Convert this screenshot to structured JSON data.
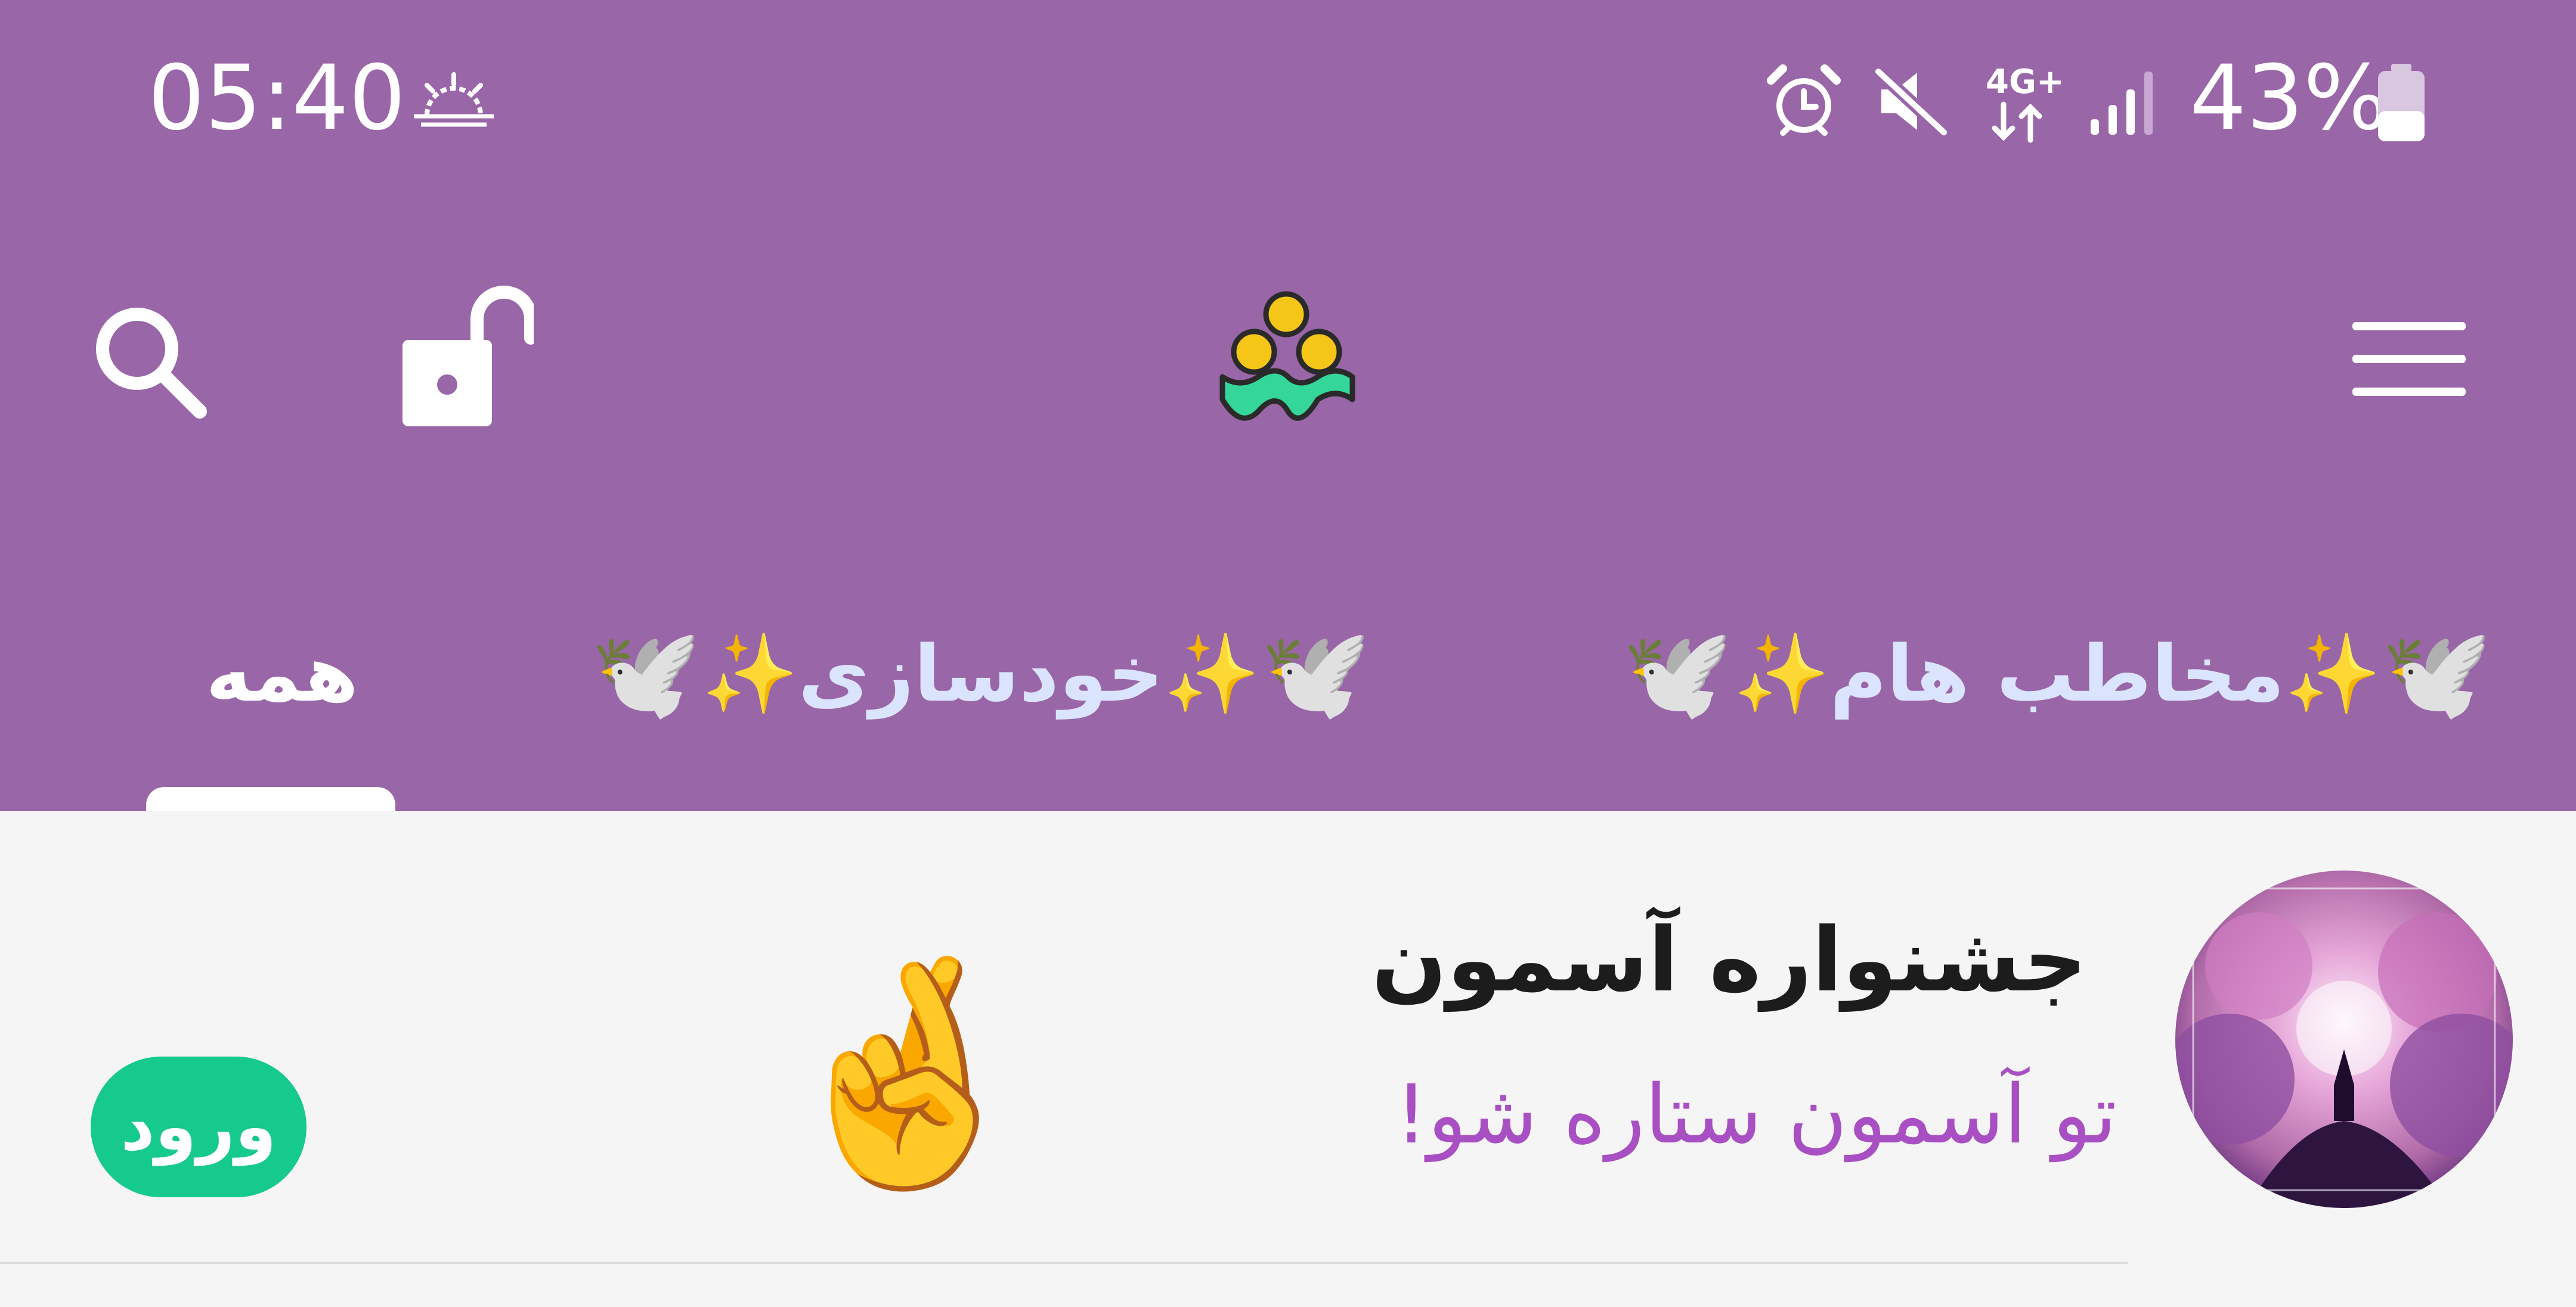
{
  "colors": {
    "header_bg": "#9966a8",
    "tab_text_active": "#ffffff",
    "tab_text_inactive": "#dbe4ff",
    "accent_green": "#16c98c",
    "subtitle_purple": "#a84fc3",
    "list_bg": "#f5f5f5"
  },
  "status_bar": {
    "time": "05:40",
    "network": "4G+",
    "battery_percent": "43%",
    "battery_level": 0.43,
    "icons": [
      "sunrise-icon",
      "alarm-icon",
      "mute-icon",
      "network-arrows-icon",
      "signal-icon",
      "battery-icon"
    ]
  },
  "toolbar": {
    "icons": [
      "search-icon",
      "unlock-icon",
      "app-logo",
      "menu-icon"
    ]
  },
  "tabs": [
    {
      "label": "همه",
      "active": true
    },
    {
      "label": "خودسازی",
      "active": false,
      "decorations": [
        "dove-emoji",
        "sparkles-emoji"
      ]
    },
    {
      "label": "مخاطب هام",
      "active": false,
      "decorations": [
        "dove-emoji",
        "sparkles-emoji"
      ]
    }
  ],
  "chats": [
    {
      "title": "جشنواره آسمون",
      "subtitle": "تو آسمون ستاره شو!",
      "emoji": "🤞",
      "action_label": "ورود",
      "avatar": "festival-avatar"
    }
  ]
}
